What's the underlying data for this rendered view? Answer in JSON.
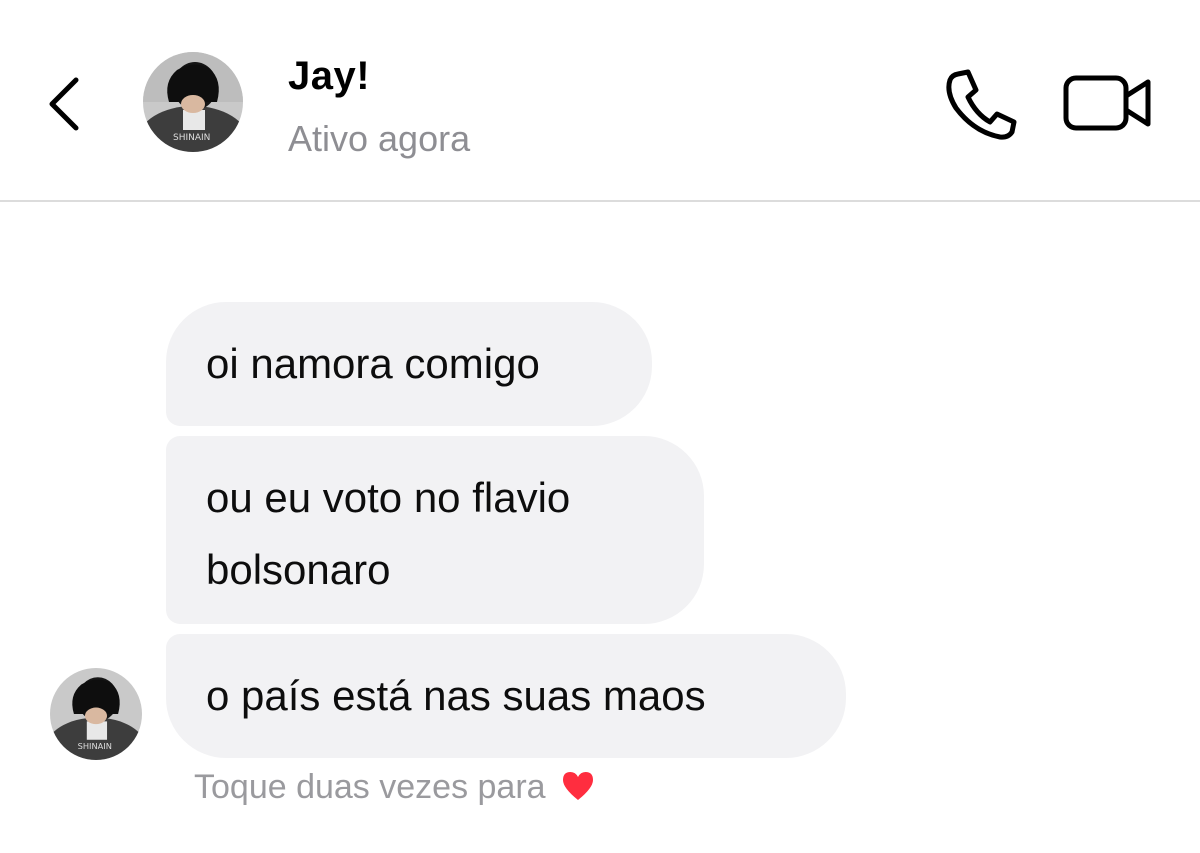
{
  "header": {
    "back_icon": "chevron-left-icon",
    "contact_name": "Jay!",
    "status": "Ativo agora",
    "call_icon": "phone-icon",
    "video_icon": "video-camera-icon"
  },
  "messages": [
    {
      "lines": [
        "oi namora comigo"
      ]
    },
    {
      "lines": [
        "ou eu voto no flavio",
        "bolsonaro"
      ]
    },
    {
      "lines": [
        "o país está nas suas maos"
      ]
    }
  ],
  "hint": {
    "text": "Toque duas vezes para",
    "icon": "heart-icon",
    "icon_color": "#ff2d3f"
  },
  "colors": {
    "bubble_bg": "#f2f2f4",
    "status_text": "#8e8e93",
    "hint_text": "#9a9a9e",
    "divider": "#dcdcdc"
  }
}
